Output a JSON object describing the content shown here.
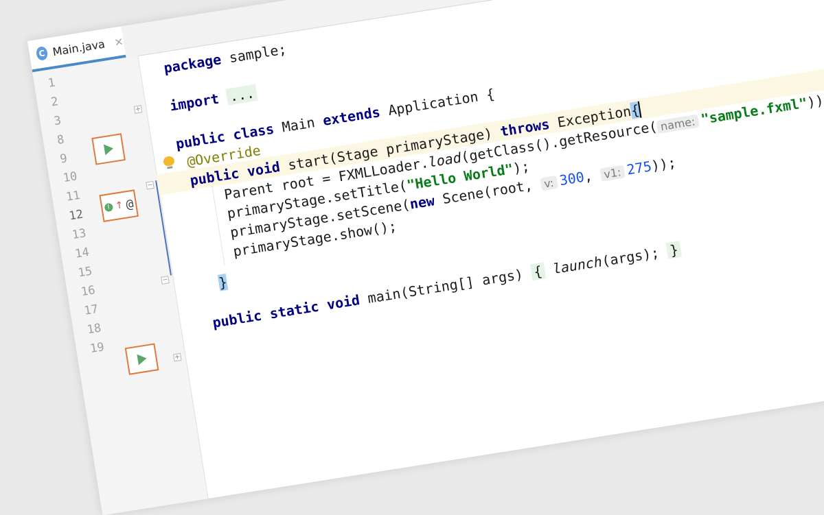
{
  "tab": {
    "icon_letter": "C",
    "label": "Main.java",
    "close": "×"
  },
  "gutter": {
    "line_numbers": [
      "1",
      "2",
      "3",
      "8",
      "9",
      "10",
      "11",
      "12",
      "13",
      "14",
      "15",
      "16",
      "17",
      "18",
      "19"
    ],
    "current_line": "12"
  },
  "code": {
    "l1": {
      "kw": "package",
      "rest": " sample;"
    },
    "l2": {
      "kw": "import",
      "folded": "..."
    },
    "l3": {
      "kw1": "public",
      "kw2": "class",
      "name": " Main ",
      "kw3": "extends",
      "rest": " Application {"
    },
    "l8": {
      "anno": "@Override"
    },
    "l9": {
      "kw1": "public",
      "kw2": "void",
      "mid": " start(Stage primaryStage) ",
      "kw3": "throws",
      "rest": " Exception",
      "brace": "{"
    },
    "l10": {
      "pre": "Parent root = FXMLLoader.",
      "method": "load",
      "mid": "(getClass().getResource(",
      "hint": "name:",
      "str": "\"sample.fxml\"",
      "post": "));"
    },
    "l11": {
      "pre": "primaryStage.setTitle(",
      "str": "\"Hello World\"",
      "post": ");"
    },
    "l12": {
      "pre": "primaryStage.setScene(",
      "kw": "new",
      "mid": " Scene(root, ",
      "hint1": "v:",
      "num1": "300",
      "comma": ", ",
      "hint2": "v1:",
      "num2": "275",
      "post": "));"
    },
    "l13": {
      "text": "primaryStage.show();"
    },
    "l14": {
      "brace": "}"
    },
    "l16": {
      "kw1": "public",
      "kw2": "static",
      "kw3": "void",
      "mid": " main(String[] args) ",
      "open": "{",
      "call": "launch",
      "args": "(args); ",
      "close": "}"
    }
  },
  "colors": {
    "keyword": "#000080",
    "annotation": "#808000",
    "string": "#067d17",
    "number": "#1750eb",
    "gutter_marker_border": "#e07a3a",
    "run_icon": "#59a869",
    "tab_underline": "#4a88c7"
  },
  "icons": {
    "tab_icon": "java-class-icon",
    "run": "run-triangle-icon",
    "override": "override-marker-icon",
    "bulb": "intention-bulb-icon"
  }
}
